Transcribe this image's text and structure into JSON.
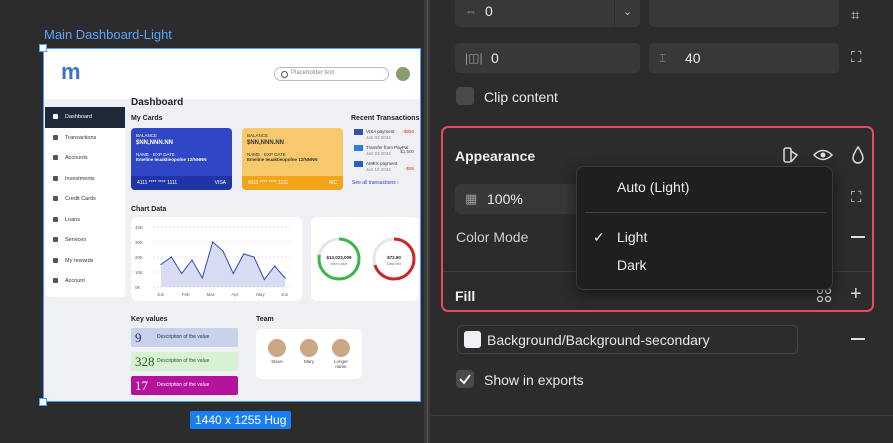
{
  "canvas": {
    "frame_label": "Main Dashboard-Light",
    "size_badge": "1440 x 1255 Hug",
    "dashboard": {
      "logo": "m",
      "search_placeholder": "Placeholder text",
      "sidebar": [
        "Dashboard",
        "Transactions",
        "Accounts",
        "Investments",
        "Credit Cards",
        "Loans",
        "Services",
        "My rewards",
        "Account"
      ],
      "title": "Dashboard",
      "my_cards_title": "My Cards",
      "cards": [
        {
          "balance_label": "BALANCE",
          "balance": "$NN,NNN.NN",
          "name_label": "NAME",
          "name": "Emeline Ieuaktieopolne",
          "exp_label": "EXP DATE",
          "exp": "12/NNNN",
          "number": "4111 **** **** 1111",
          "brand": "VISA"
        },
        {
          "balance_label": "BALANCE",
          "balance": "$NN,NNN.NN",
          "name_label": "NAME",
          "name": "Emeline Ieuaktieopolne",
          "exp_label": "EXP DATE",
          "exp": "12/NNNN",
          "number": "4111 **** **** 1111",
          "brand": "MC"
        }
      ],
      "recent_title": "Recent Transactions",
      "transactions": [
        {
          "name": "VISA payment",
          "date": "Jan 02 2024",
          "amount": "-$850"
        },
        {
          "name": "Transfer from PayPal",
          "date": "Jan 23 2024",
          "amount": "$1,500"
        },
        {
          "name": "AMEX payment",
          "date": "Jan 10 2024",
          "amount": "-$95"
        }
      ],
      "see_all": "See all transactions ›",
      "chart_title": "Chart Data",
      "chart_data": {
        "type": "line",
        "categories": [
          "Jun",
          "Feb",
          "Mar",
          "Apr",
          "May",
          "Jun"
        ],
        "values": [
          1.5,
          2.0,
          0.9,
          1.8,
          0.6,
          3.0,
          2.4,
          0.9,
          2.2,
          2.0,
          0.5,
          1.4,
          0.6
        ],
        "yticks": [
          "40K",
          "30K",
          "20K",
          "10K",
          "0K"
        ],
        "ylim": [
          0,
          4
        ]
      },
      "donuts": [
        {
          "value": "$12,023,009",
          "sub": "label value",
          "color": "#3cb54a",
          "pct": 0.78
        },
        {
          "value": "$72.60",
          "sub": "Data text",
          "color": "#c62828",
          "pct": 0.7
        }
      ],
      "key_values_title": "Key values",
      "key_values": [
        {
          "num": "9",
          "desc": "Description of the value",
          "bg": "#c8d2ea",
          "fg": "#1b2b5e"
        },
        {
          "num": "328",
          "desc": "Description of the value",
          "bg": "#d8f0d4",
          "fg": "#1e5e1e"
        },
        {
          "num": "17",
          "desc": "Description of the value",
          "bg": "#b5139b",
          "fg": "#ffffff"
        }
      ],
      "team_title": "Team",
      "team": [
        "Steve",
        "Mary",
        "Longer name"
      ]
    }
  },
  "props": {
    "top_row": {
      "left_value": "0"
    },
    "padding_row": {
      "left_value": "0",
      "right_value": "40"
    },
    "clip_content_label": "Clip content",
    "appearance": {
      "title": "Appearance",
      "opacity_value": "100%",
      "color_mode_label": "Color Mode",
      "dropdown": {
        "options": [
          {
            "label": "Auto (Light)",
            "checked": false
          },
          {
            "label": "Light",
            "checked": true
          },
          {
            "label": "Dark",
            "checked": false
          }
        ],
        "check_glyph": "✓"
      }
    },
    "fill": {
      "title": "Fill",
      "style_name": "Background/Background-secondary",
      "show_in_exports_label": "Show in exports",
      "show_in_exports_checked": true
    },
    "accent_color": "#e84a63"
  }
}
